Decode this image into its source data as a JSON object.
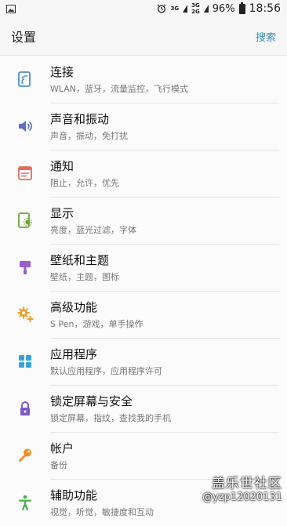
{
  "status": {
    "net1": "3G",
    "net2": "3G",
    "net3": "2G",
    "battery": "96%",
    "time": "18:56",
    "battery_level": 0.96
  },
  "header": {
    "title": "设置",
    "search": "搜索"
  },
  "items": [
    {
      "label": "连接",
      "sub": "WLAN，蓝牙，流量监控，飞行模式",
      "icon": "connection-icon",
      "color": "#4a90c8"
    },
    {
      "label": "声音和振动",
      "sub": "声音，振动，免打扰",
      "icon": "sound-icon",
      "color": "#5b6fd1"
    },
    {
      "label": "通知",
      "sub": "阻止，允许，优先",
      "icon": "notification-icon",
      "color": "#e26d5c"
    },
    {
      "label": "显示",
      "sub": "亮度，蓝光过滤，字体",
      "icon": "display-icon",
      "color": "#6fa83a"
    },
    {
      "label": "壁纸和主题",
      "sub": "壁纸，主题，图标",
      "icon": "wallpaper-icon",
      "color": "#9b5cc9"
    },
    {
      "label": "高级功能",
      "sub": "S Pen，游戏，单手操作",
      "icon": "advanced-gear-icon",
      "color": "#e9a228"
    },
    {
      "label": "应用程序",
      "sub": "默认应用程序，应用程序许可",
      "icon": "apps-icon",
      "color": "#3aa0d8"
    },
    {
      "label": "锁定屏幕与安全",
      "sub": "锁定屏幕，指纹，查找我的手机",
      "icon": "lock-icon",
      "color": "#7a5ac4"
    },
    {
      "label": "帐户",
      "sub": "备份",
      "icon": "key-icon",
      "color": "#f0902b"
    },
    {
      "label": "辅助功能",
      "sub": "视觉，听觉，敏捷度和互动",
      "icon": "accessibility-icon",
      "color": "#4caf50"
    }
  ],
  "watermark": {
    "line1": "盖乐世社区",
    "line2": "@yzp12020131"
  }
}
